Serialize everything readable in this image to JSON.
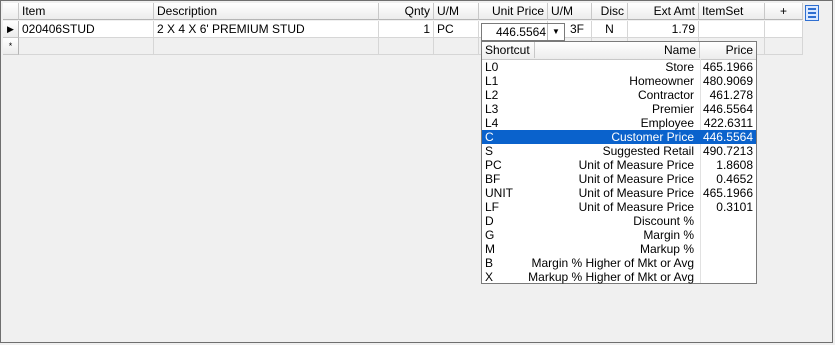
{
  "header": {
    "item": "Item",
    "description": "Description",
    "qnty": "Qnty",
    "um": "U/M",
    "unit_price": "Unit Price",
    "um2": "U/M",
    "disc": "Disc",
    "ext_amt": "Ext Amt",
    "itemset": "ItemSet",
    "plus": "+"
  },
  "rows": [
    {
      "indicator": "▶",
      "item": "020406STUD",
      "description": "2 X 4 X 6' PREMIUM STUD",
      "qnty": "1",
      "um": "PC",
      "um2_partial": "3F",
      "disc": "N",
      "ext_amt": "1.79"
    }
  ],
  "new_row_indicator": "*",
  "editor": {
    "value": "446.5564",
    "dropdown_icon": "▼"
  },
  "price_popup": {
    "headers": {
      "shortcut": "Shortcut",
      "name": "Name",
      "price": "Price"
    },
    "rows": [
      {
        "shortcut": "L0",
        "name": "Store",
        "price": "465.1966"
      },
      {
        "shortcut": "L1",
        "name": "Homeowner",
        "price": "480.9069"
      },
      {
        "shortcut": "L2",
        "name": "Contractor",
        "price": "461.278"
      },
      {
        "shortcut": "L3",
        "name": "Premier",
        "price": "446.5564"
      },
      {
        "shortcut": "L4",
        "name": "Employee",
        "price": "422.6311"
      },
      {
        "shortcut": "C",
        "name": "Customer Price",
        "price": "446.5564",
        "selected": true
      },
      {
        "shortcut": "S",
        "name": "Suggested Retail",
        "price": "490.7213"
      },
      {
        "shortcut": "PC",
        "name": "Unit of Measure Price",
        "price": "1.8608"
      },
      {
        "shortcut": "BF",
        "name": "Unit of Measure Price",
        "price": "0.4652"
      },
      {
        "shortcut": "UNIT",
        "name": "Unit of Measure Price",
        "price": "465.1966"
      },
      {
        "shortcut": "LF",
        "name": "Unit of Measure Price",
        "price": "0.3101"
      },
      {
        "shortcut": "D",
        "name": "Discount %",
        "price": ""
      },
      {
        "shortcut": "G",
        "name": "Margin %",
        "price": ""
      },
      {
        "shortcut": "M",
        "name": "Markup %",
        "price": ""
      },
      {
        "shortcut": "B",
        "name": "Margin % Higher of Mkt or Avg",
        "price": ""
      },
      {
        "shortcut": "X",
        "name": "Markup % Higher of Mkt or Avg",
        "price": ""
      }
    ]
  },
  "colors": {
    "selection": "#0a62cc",
    "menu_icon": "#2f6fd1"
  }
}
